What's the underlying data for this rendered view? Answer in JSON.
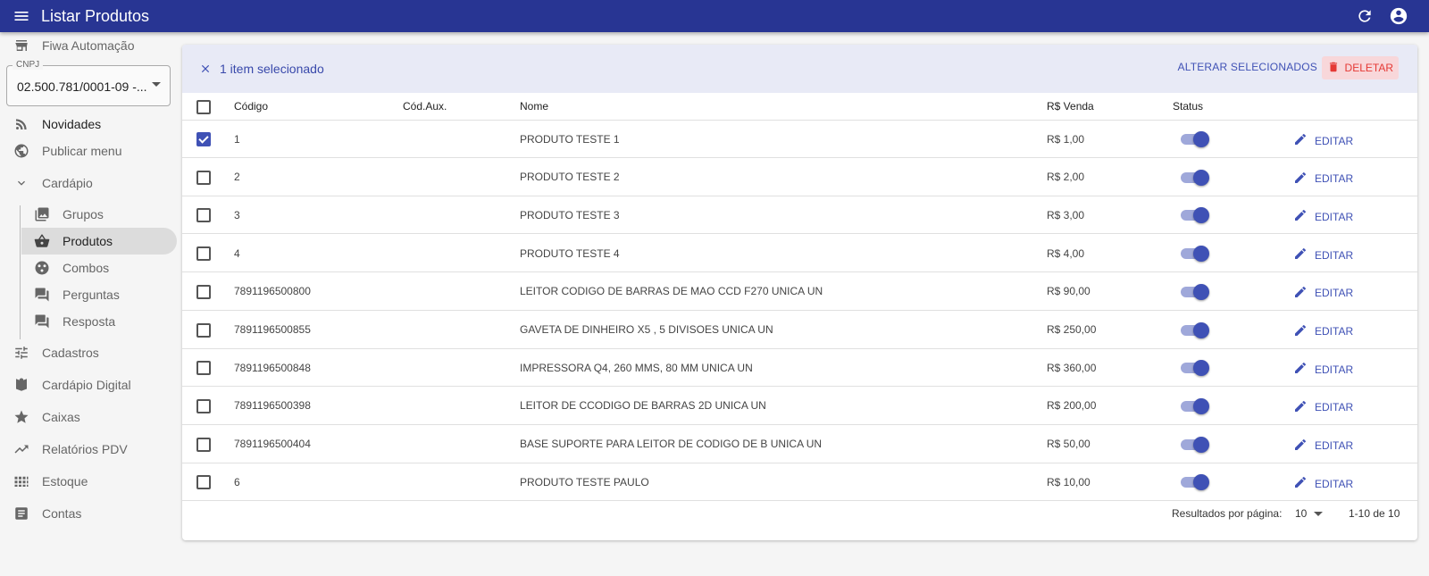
{
  "appbar": {
    "title": "Listar Produtos"
  },
  "sidebar": {
    "company": "Fiwa Automação",
    "cnpj_label": "CNPJ",
    "cnpj_value": "02.500.781/0001-09 -...",
    "items": [
      {
        "label": "Novidades",
        "icon": "rss-icon"
      },
      {
        "label": "Publicar menu",
        "icon": "globe-icon"
      },
      {
        "label": "Cardápio",
        "icon": "chevron-down-icon"
      },
      {
        "label": "Grupos",
        "icon": "photo-library-icon"
      },
      {
        "label": "Produtos",
        "icon": "basket-icon"
      },
      {
        "label": "Combos",
        "icon": "combos-icon"
      },
      {
        "label": "Perguntas",
        "icon": "chat-icon"
      },
      {
        "label": "Resposta",
        "icon": "chat-icon"
      },
      {
        "label": "Cadastros",
        "icon": "tune-icon"
      },
      {
        "label": "Cardápio Digital",
        "icon": "menu-book-icon"
      },
      {
        "label": "Caixas",
        "icon": "star-icon"
      },
      {
        "label": "Relatórios PDV",
        "icon": "trending-up-icon"
      },
      {
        "label": "Estoque",
        "icon": "grid-icon"
      },
      {
        "label": "Contas",
        "icon": "document-icon"
      }
    ]
  },
  "selection": {
    "count_text": "1 item selecionado",
    "alter_label": "ALTERAR SELECIONADOS",
    "delete_label": "DELETAR"
  },
  "table": {
    "headers": {
      "code": "Código",
      "aux": "Cód.Aux.",
      "name": "Nome",
      "price": "R$ Venda",
      "status": "Status"
    },
    "edit_label": "EDITAR",
    "rows": [
      {
        "code": "1",
        "name": "PRODUTO TESTE 1",
        "price": "R$ 1,00",
        "checked": true,
        "active": true
      },
      {
        "code": "2",
        "name": "PRODUTO TESTE 2",
        "price": "R$ 2,00",
        "checked": false,
        "active": true
      },
      {
        "code": "3",
        "name": "PRODUTO TESTE 3",
        "price": "R$ 3,00",
        "checked": false,
        "active": true
      },
      {
        "code": "4",
        "name": "PRODUTO TESTE 4",
        "price": "R$ 4,00",
        "checked": false,
        "active": true
      },
      {
        "code": "7891196500800",
        "name": "LEITOR CODIGO DE BARRAS DE MAO CCD F270 UNICA UN",
        "price": "R$ 90,00",
        "checked": false,
        "active": true
      },
      {
        "code": "7891196500855",
        "name": "GAVETA DE DINHEIRO X5 , 5 DIVISOES UNICA UN",
        "price": "R$ 250,00",
        "checked": false,
        "active": true
      },
      {
        "code": "7891196500848",
        "name": "IMPRESSORA Q4, 260 MMS, 80 MM UNICA UN",
        "price": "R$ 360,00",
        "checked": false,
        "active": true
      },
      {
        "code": "7891196500398",
        "name": "LEITOR DE CCODIGO DE BARRAS 2D UNICA UN",
        "price": "R$ 200,00",
        "checked": false,
        "active": true
      },
      {
        "code": "7891196500404",
        "name": "BASE SUPORTE PARA LEITOR DE CODIGO DE B UNICA UN",
        "price": "R$ 50,00",
        "checked": false,
        "active": true
      },
      {
        "code": "6",
        "name": "PRODUTO TESTE PAULO",
        "price": "R$ 10,00",
        "checked": false,
        "active": true
      }
    ]
  },
  "pagination": {
    "label": "Resultados por página:",
    "per_page": "10",
    "range": "1-10 de 10"
  },
  "colors": {
    "primary": "#283593",
    "accent": "#3f51b5",
    "danger": "#e53935",
    "selection_bg": "#e8eaf6"
  }
}
